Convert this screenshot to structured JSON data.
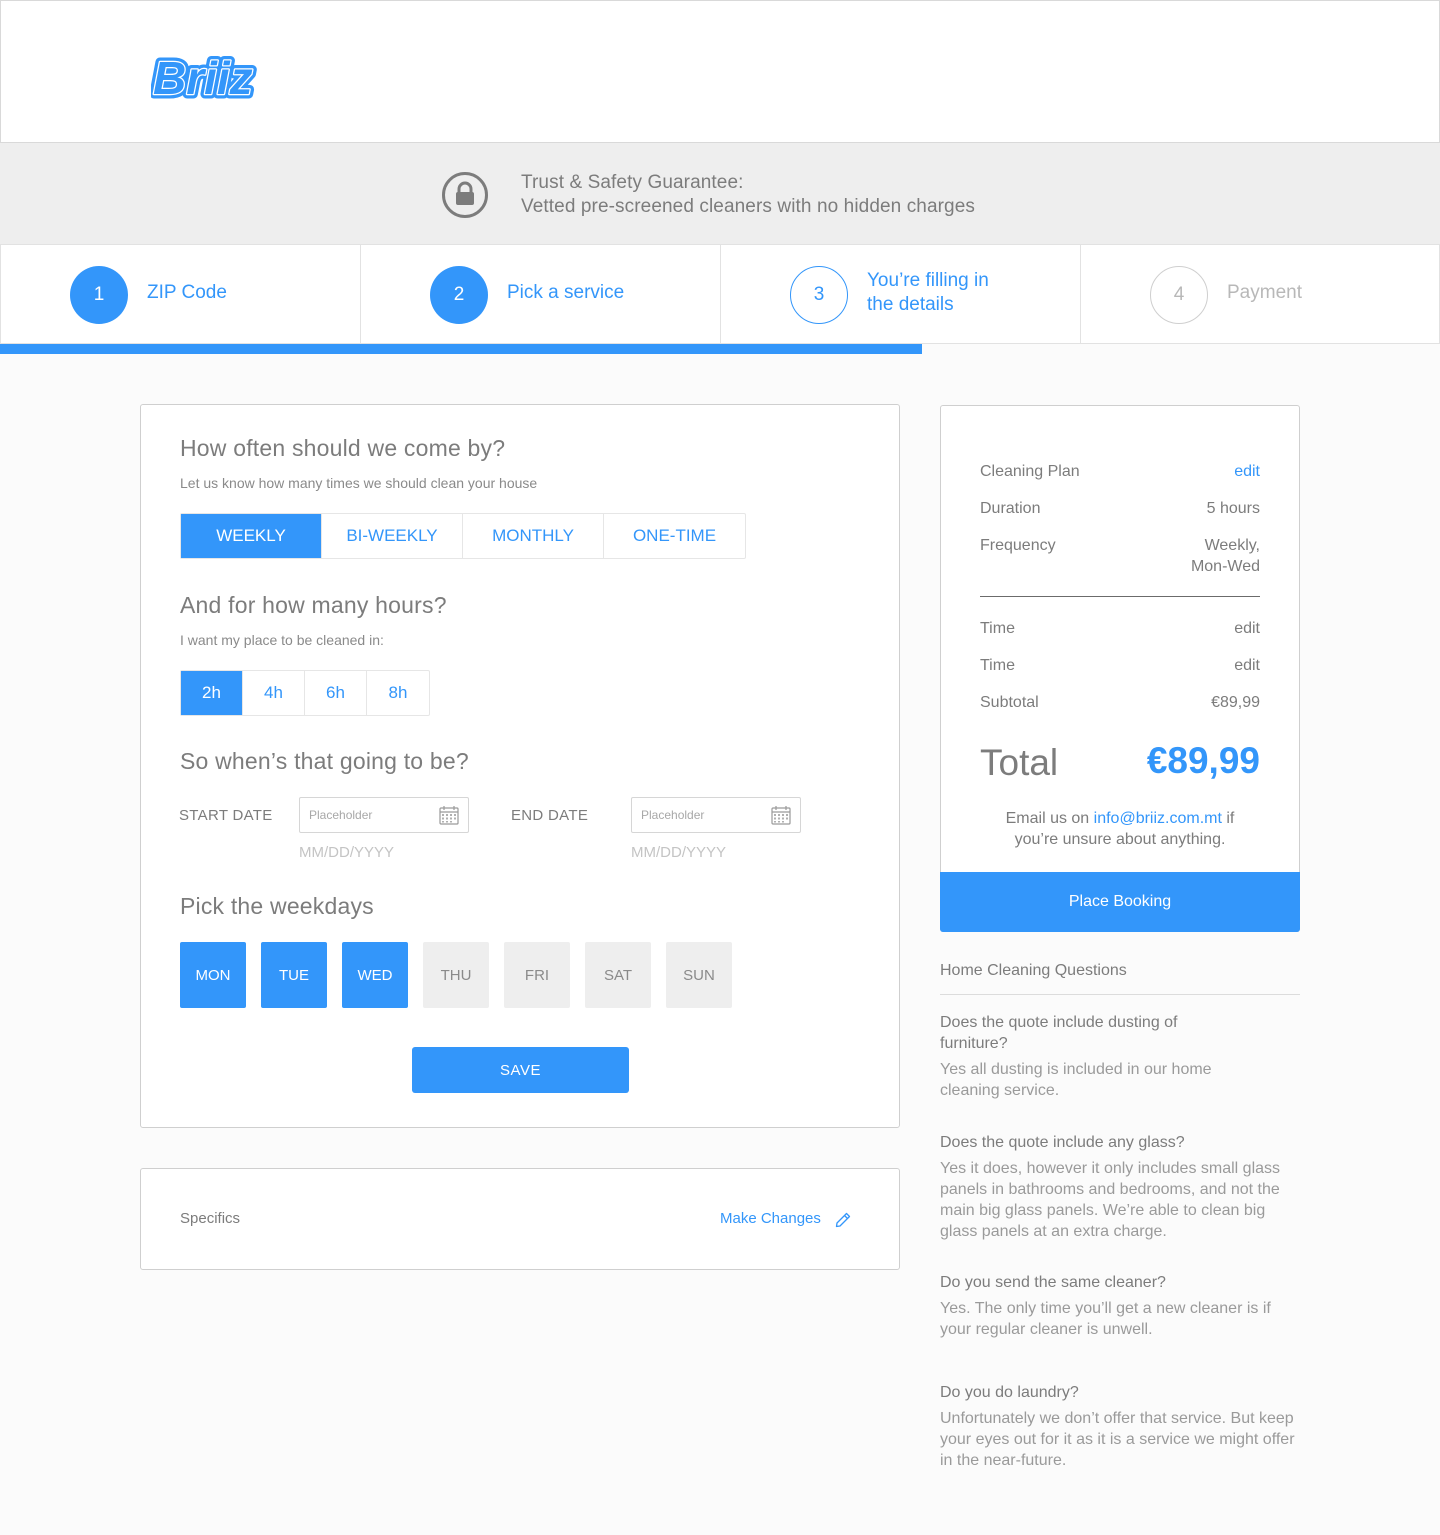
{
  "brand": {
    "logo_text": "Briiz",
    "accent_color": "#3396fa"
  },
  "trust": {
    "title": "Trust & Safety Guarantee:",
    "subtitle": "Vetted pre-screened cleaners with no hidden charges",
    "icon": "lock-icon"
  },
  "steps": [
    {
      "number": "1",
      "label": "ZIP Code",
      "status": "done"
    },
    {
      "number": "2",
      "label": "Pick a service",
      "status": "done"
    },
    {
      "number": "3",
      "label_line1": "You’re filling in",
      "label_line2": "the details",
      "status": "current"
    },
    {
      "number": "4",
      "label": "Payment",
      "status": "todo"
    }
  ],
  "progress": {
    "completed_fraction": 0.64
  },
  "frequency": {
    "heading": "How often should we come by?",
    "subtitle": "Let us know how many times we should clean your house",
    "options": [
      "WEEKLY",
      "BI-WEEKLY",
      "MONTHLY",
      "ONE-TIME"
    ],
    "selected": "WEEKLY"
  },
  "hours": {
    "heading": "And for how many hours?",
    "subtitle": "I want my place to be cleaned in:",
    "options": [
      "2h",
      "4h",
      "6h",
      "8h"
    ],
    "selected": "2h"
  },
  "dates": {
    "heading": "So when’s that going to be?",
    "start_label": "START DATE",
    "end_label": "END DATE",
    "placeholder": "Placeholder",
    "format_hint": "MM/DD/YYYY"
  },
  "weekdays": {
    "heading": "Pick the weekdays",
    "days": [
      "MON",
      "TUE",
      "WED",
      "THU",
      "FRI",
      "SAT",
      "SUN"
    ],
    "selected": [
      "MON",
      "TUE",
      "WED"
    ]
  },
  "save_label": "SAVE",
  "specifics": {
    "title": "Specifics",
    "link": "Make Changes"
  },
  "summary": {
    "rows": [
      {
        "label": "Cleaning Plan",
        "value": "edit"
      },
      {
        "label": "Duration",
        "value": "5 hours"
      },
      {
        "label": "Frequency",
        "value_line1": "Weekly,",
        "value_line2": "Mon-Wed"
      },
      {
        "label": "Time",
        "value": "edit"
      },
      {
        "label": "Time",
        "value": "edit"
      },
      {
        "label": "Subtotal",
        "value": "€89,99"
      }
    ],
    "total_label": "Total",
    "total_value": "€89,99",
    "email_prefix": "Email us on",
    "email": "info@briiz.com.mt",
    "email_suffix": "if",
    "email_line2": "you’re  unsure about anything.",
    "place_booking": "Place Booking"
  },
  "faq": {
    "title": "Home Cleaning Questions",
    "items": [
      {
        "q": "Does the quote include dusting of furniture?",
        "a": "Yes all dusting is included in our home cleaning service."
      },
      {
        "q": "Does the quote include any glass?",
        "a": "Yes it does, however it only includes small glass panels in bathrooms and bedrooms, and not the main big glass panels. We’re able to clean big glass panels at an extra charge."
      },
      {
        "q": "Do you send the same cleaner?",
        "a": "Yes. The only time you’ll get a new cleaner is if your regular cleaner is unwell."
      },
      {
        "q": "Do you do laundry?",
        "a": "Unfortunately we don’t offer that service. But keep your eyes out for it as it is a service we might offer in the near-future."
      }
    ]
  }
}
